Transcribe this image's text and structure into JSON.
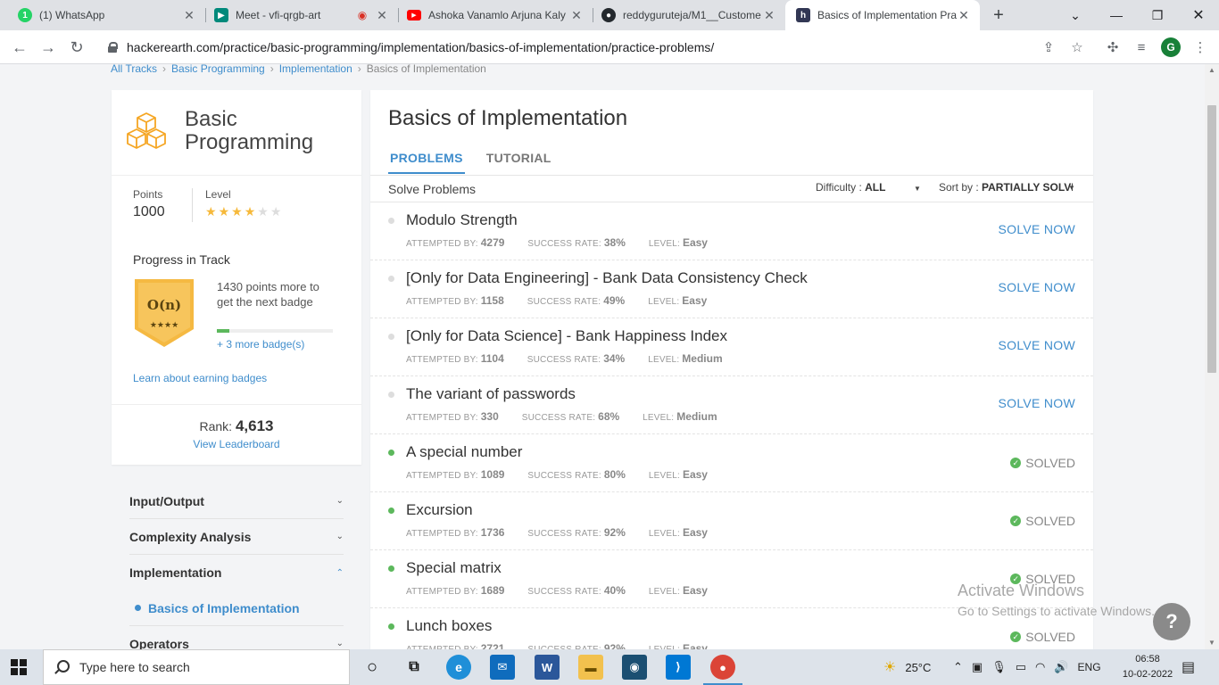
{
  "browser": {
    "tabs": [
      {
        "title": "(1) WhatsApp",
        "icon": "whatsapp-icon",
        "color": "#25d366",
        "badge": "1"
      },
      {
        "title": "Meet - vfi-qrgb-art",
        "icon": "google-meet-icon",
        "color": "#00897b",
        "badge": ""
      },
      {
        "title": "Ashoka Vanamlo Arjuna Kaly",
        "icon": "youtube-icon",
        "color": "#ff0000",
        "badge": ""
      },
      {
        "title": "reddyguruteja/M1__Custome",
        "icon": "github-icon",
        "color": "#24292e",
        "badge": ""
      },
      {
        "title": "Basics of Implementation Pra",
        "icon": "hackerearth-icon",
        "color": "#323754",
        "badge": "h"
      }
    ],
    "url": "hackerearth.com/practice/basic-programming/implementation/basics-of-implementation/practice-problems/",
    "profile_initial": "G"
  },
  "breadcrumb": [
    "All Tracks",
    "Basic Programming",
    "Implementation",
    "Basics of Implementation"
  ],
  "track": {
    "title_line1": "Basic",
    "title_line2": "Programming",
    "points_label": "Points",
    "points_value": "1000",
    "level_label": "Level",
    "level_stars": 4,
    "level_max": 6,
    "progress_title": "Progress in Track",
    "badge_symbol": "O(n)",
    "badge_stars": "★★★★",
    "badge_text": "1430 points more to get the next badge",
    "badge_progress": 0.11,
    "more_badges": "+ 3 more badge(s)",
    "learn_link": "Learn about earning badges",
    "rank_label": "Rank:",
    "rank_value": "4,613",
    "leaderboard_link": "View Leaderboard"
  },
  "topics": {
    "input_output": "Input/Output",
    "complexity": "Complexity Analysis",
    "implementation": "Implementation",
    "basics": "Basics of Implementation",
    "operators": "Operators"
  },
  "main": {
    "title": "Basics of Implementation",
    "tab_problems": "PROBLEMS",
    "tab_tutorial": "TUTORIAL",
    "solve_label": "Solve Problems",
    "difficulty_label": "Difficulty :",
    "difficulty_value": "ALL",
    "sort_label": "Sort by :",
    "sort_value": "PARTIALLY SOLVED",
    "attempted_label": "ATTEMPTED BY:",
    "success_label": "SUCCESS RATE:",
    "level_label": "LEVEL:",
    "solve_now": "SOLVE NOW",
    "solved": "SOLVED"
  },
  "problems": [
    {
      "name": "Modulo Strength",
      "attempted": "4279",
      "success": "38%",
      "level": "Easy",
      "solved": false
    },
    {
      "name": "[Only for Data Engineering] - Bank Data Consistency Check",
      "attempted": "1158",
      "success": "49%",
      "level": "Easy",
      "solved": false
    },
    {
      "name": "[Only for Data Science] - Bank Happiness Index",
      "attempted": "1104",
      "success": "34%",
      "level": "Medium",
      "solved": false
    },
    {
      "name": "The variant of passwords",
      "attempted": "330",
      "success": "68%",
      "level": "Medium",
      "solved": false
    },
    {
      "name": "A special number",
      "attempted": "1089",
      "success": "80%",
      "level": "Easy",
      "solved": true
    },
    {
      "name": "Excursion",
      "attempted": "1736",
      "success": "92%",
      "level": "Easy",
      "solved": true
    },
    {
      "name": "Special matrix",
      "attempted": "1689",
      "success": "40%",
      "level": "Easy",
      "solved": true
    },
    {
      "name": "Lunch boxes",
      "attempted": "2721",
      "success": "92%",
      "level": "Easy",
      "solved": true
    }
  ],
  "watermark": {
    "line1": "Activate Windows",
    "line2": "Go to Settings to activate Windows."
  },
  "taskbar": {
    "search_placeholder": "Type here to search",
    "weather": "25°C",
    "language": "ENG",
    "time": "06:58",
    "date": "10-02-2022"
  }
}
